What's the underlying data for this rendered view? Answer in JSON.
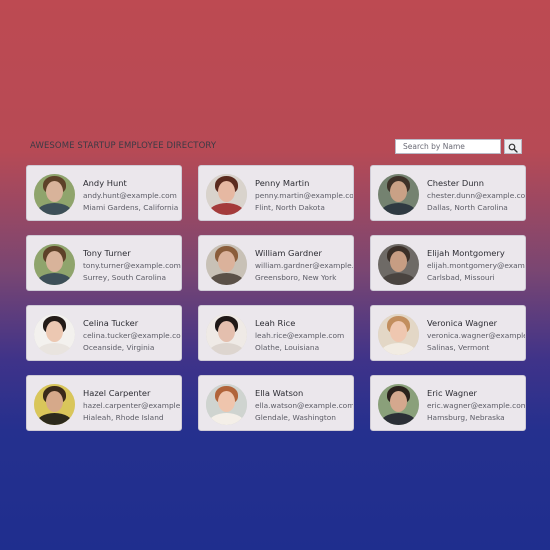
{
  "header": {
    "title": "AWESOME STARTUP EMPLOYEE DIRECTORY",
    "search_placeholder": "Search by Name",
    "search_icon": "magnifier-icon"
  },
  "employees": [
    {
      "name": "Andy Hunt",
      "email": "andy.hunt@example.com",
      "location": "Miami Gardens, California",
      "avatar": {
        "bg": "#8fa46c",
        "hair": "#5d4128",
        "skin": "#d8b39a",
        "shirt": "#3d4f58"
      }
    },
    {
      "name": "Penny Martin",
      "email": "penny.martin@example.com",
      "location": "Flint, North Dakota",
      "avatar": {
        "bg": "#d9d3cc",
        "hair": "#5a2a1e",
        "skin": "#e6b8a2",
        "shirt": "#a43b3b"
      }
    },
    {
      "name": "Chester Dunn",
      "email": "chester.dunn@example.com",
      "location": "Dallas, North Carolina",
      "avatar": {
        "bg": "#748270",
        "hair": "#3d3128",
        "skin": "#c9a186",
        "shirt": "#2f3a42"
      }
    },
    {
      "name": "Tony Turner",
      "email": "tony.turner@example.com",
      "location": "Surrey, South Carolina",
      "avatar": {
        "bg": "#8fa46c",
        "hair": "#5d4128",
        "skin": "#d8b39a",
        "shirt": "#3d4f58"
      }
    },
    {
      "name": "William Gardner",
      "email": "william.gardner@example.com",
      "location": "Greensboro, New York",
      "avatar": {
        "bg": "#c8c1b6",
        "hair": "#8a5d3b",
        "skin": "#dbb29b",
        "shirt": "#5b5148"
      }
    },
    {
      "name": "Elijah Montgomery",
      "email": "elijah.montgomery@example.com",
      "location": "Carlsbad, Missouri",
      "avatar": {
        "bg": "#6e6a66",
        "hair": "#3a2f28",
        "skin": "#c79d83",
        "shirt": "#4a4440"
      }
    },
    {
      "name": "Celina Tucker",
      "email": "celina.tucker@example.com",
      "location": "Oceanside, Virginia",
      "avatar": {
        "bg": "#f3f1ee",
        "hair": "#231b17",
        "skin": "#ecc8b2",
        "shirt": "#e9e4df"
      }
    },
    {
      "name": "Leah Rice",
      "email": "leah.rice@example.com",
      "location": "Olathe, Louisiana",
      "avatar": {
        "bg": "#efeae6",
        "hair": "#1f1816",
        "skin": "#e4bfae",
        "shirt": "#ddd5cf"
      }
    },
    {
      "name": "Veronica Wagner",
      "email": "veronica.wagner@example.com",
      "location": "Salinas, Vermont",
      "avatar": {
        "bg": "#e3d7c6",
        "hair": "#c28e5e",
        "skin": "#efc7b0",
        "shirt": "#f2ece3"
      }
    },
    {
      "name": "Hazel Carpenter",
      "email": "hazel.carpenter@example.com",
      "location": "Hialeah, Rhode Island",
      "avatar": {
        "bg": "#d9c65a",
        "hair": "#3a2a1a",
        "skin": "#d6a98a",
        "shirt": "#2c2a1c"
      }
    },
    {
      "name": "Ella Watson",
      "email": "ella.watson@example.com",
      "location": "Glendale, Washington",
      "avatar": {
        "bg": "#cfd4d0",
        "hair": "#b1643a",
        "skin": "#efc5ad",
        "shirt": "#f4efe8"
      }
    },
    {
      "name": "Eric Wagner",
      "email": "eric.wagner@example.com",
      "location": "Hamsburg, Nebraska",
      "avatar": {
        "bg": "#8aa07a",
        "hair": "#2a211c",
        "skin": "#d4a88e",
        "shirt": "#2b2f36"
      }
    }
  ]
}
